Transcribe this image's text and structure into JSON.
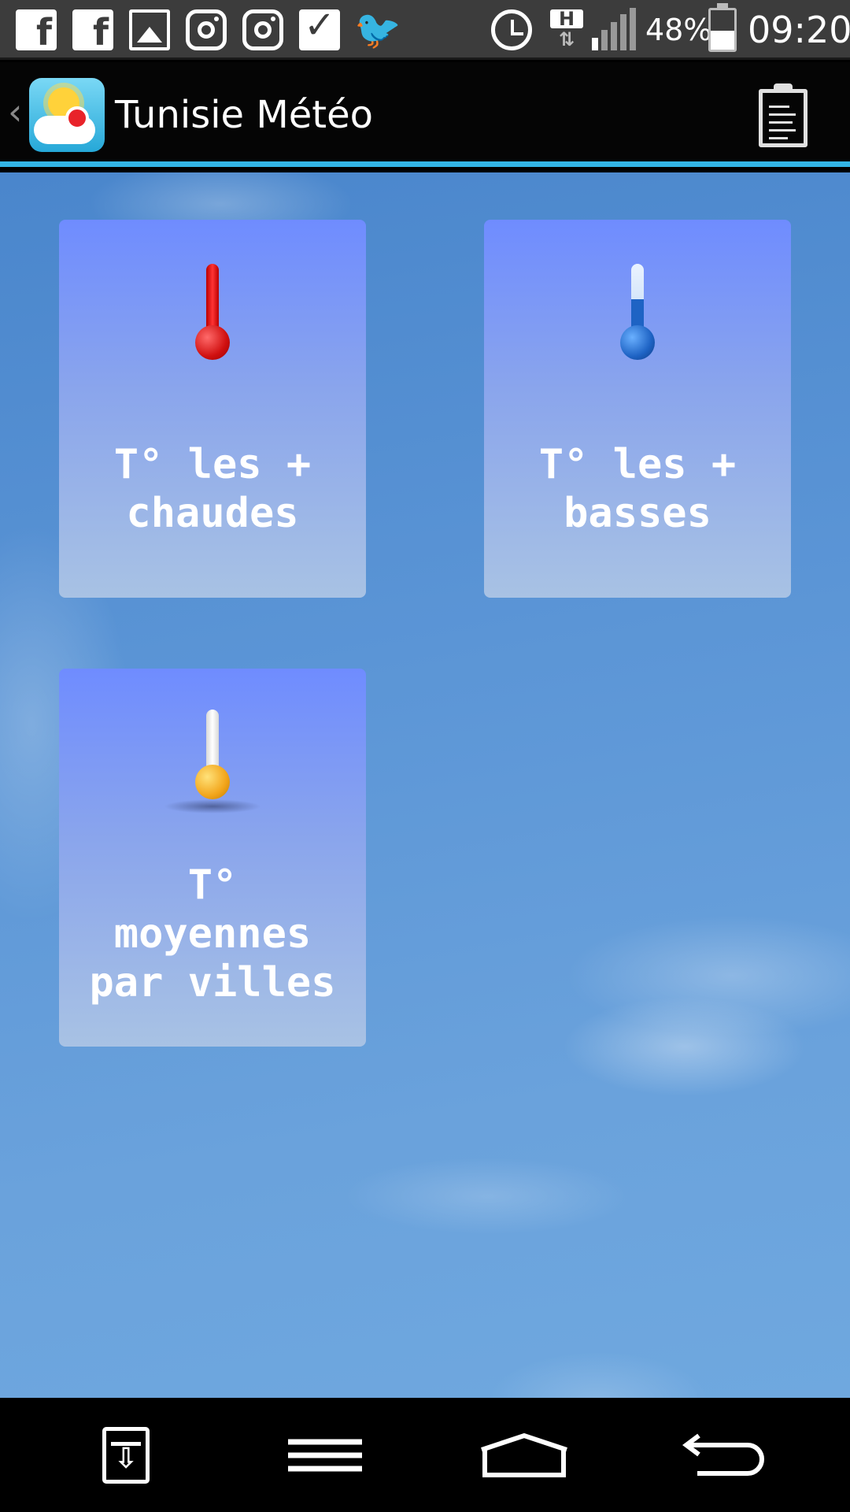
{
  "status_bar": {
    "notification_icons": [
      "facebook-icon",
      "facebook-icon",
      "gallery-icon",
      "instagram-icon",
      "instagram-icon",
      "checkmark-icon",
      "twitter-icon"
    ],
    "network_label": "H",
    "battery_percent": "48%",
    "battery_level": 0.48,
    "time": "09:20"
  },
  "action_bar": {
    "title": "Tunisie Météo",
    "menu_icon": "clipboard-icon"
  },
  "tiles": [
    {
      "label": "T° les +\nchaudes",
      "icon": "thermometer-hot-icon",
      "color": "#e02020"
    },
    {
      "label": "T° les +\nbasses",
      "icon": "thermometer-cold-icon",
      "color": "#1e63c4"
    },
    {
      "label": "T°\nmoyennes\npar villes",
      "icon": "thermometer-average-icon",
      "color": "#f2a51b"
    }
  ],
  "nav_bar": {
    "buttons": [
      "save-icon",
      "menu-icon",
      "home-icon",
      "back-icon"
    ]
  }
}
